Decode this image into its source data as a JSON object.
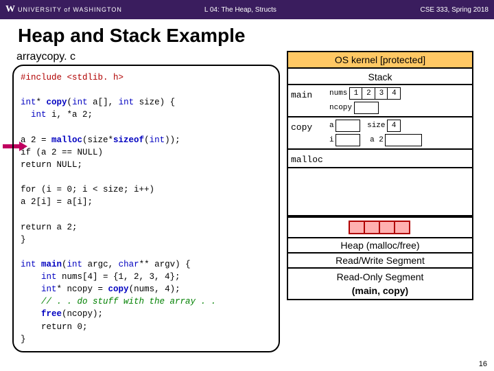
{
  "header": {
    "uni_letter": "W",
    "uni_name": "UNIVERSITY of WASHINGTON",
    "lecture": "L 04: The Heap, Structs",
    "course": "CSE 333, Spring 2018"
  },
  "title": "Heap and Stack Example",
  "filename": "arraycopy. c",
  "code": {
    "l1": "#include <stdlib. h>",
    "l2a": "int",
    "l2b": "*",
    "l2c": " copy",
    "l2d": "(",
    "l2e": "int",
    "l2f": " a[], ",
    "l2g": "int",
    "l2h": " size) {",
    "l3a": "int",
    "l3b": " i, *a 2;",
    "l4": "  a 2 = ",
    "l4b": "malloc",
    "l4c": "(size*",
    "l4d": "sizeof",
    "l4e": "(",
    "l4f": "int",
    "l4g": "));",
    "l5": "  if (a 2 == NULL)",
    "l6": "    return NULL;",
    "l7": "  for (i = 0; i < size; i++)",
    "l8": "    a 2[i] = a[i];",
    "l9": "  return a 2;",
    "l10": "}",
    "m1a": "int",
    "m1b": " main",
    "m1c": "(",
    "m1d": "int",
    "m1e": " argc, ",
    "m1f": "char",
    "m1g": "** argv) {",
    "m2a": "int",
    "m2b": " nums[4] = {1, 2, 3, 4};",
    "m3a": "int",
    "m3b": "* ncopy = ",
    "m3c": "copy",
    "m3d": "(nums, 4);",
    "m4": "// . . do stuff with the array . .",
    "m5a": "free",
    "m5b": "(ncopy);",
    "m6": "return 0;",
    "m7": "}"
  },
  "memory": {
    "os": "OS kernel [protected]",
    "stack": "Stack",
    "main": "main",
    "copy": "copy",
    "malloc": "malloc",
    "nums": "nums",
    "ncopy": "ncopy",
    "a": "a",
    "size": "size",
    "i": "i",
    "a2": "a 2",
    "v1": "1",
    "v2": "2",
    "v3": "3",
    "v4": "4",
    "sz": "4",
    "heap": "Heap (malloc/free)",
    "rw": "Read/Write Segment",
    "ro1": "Read-Only Segment",
    "ro2": "(main, copy)"
  },
  "pagenum": "16"
}
